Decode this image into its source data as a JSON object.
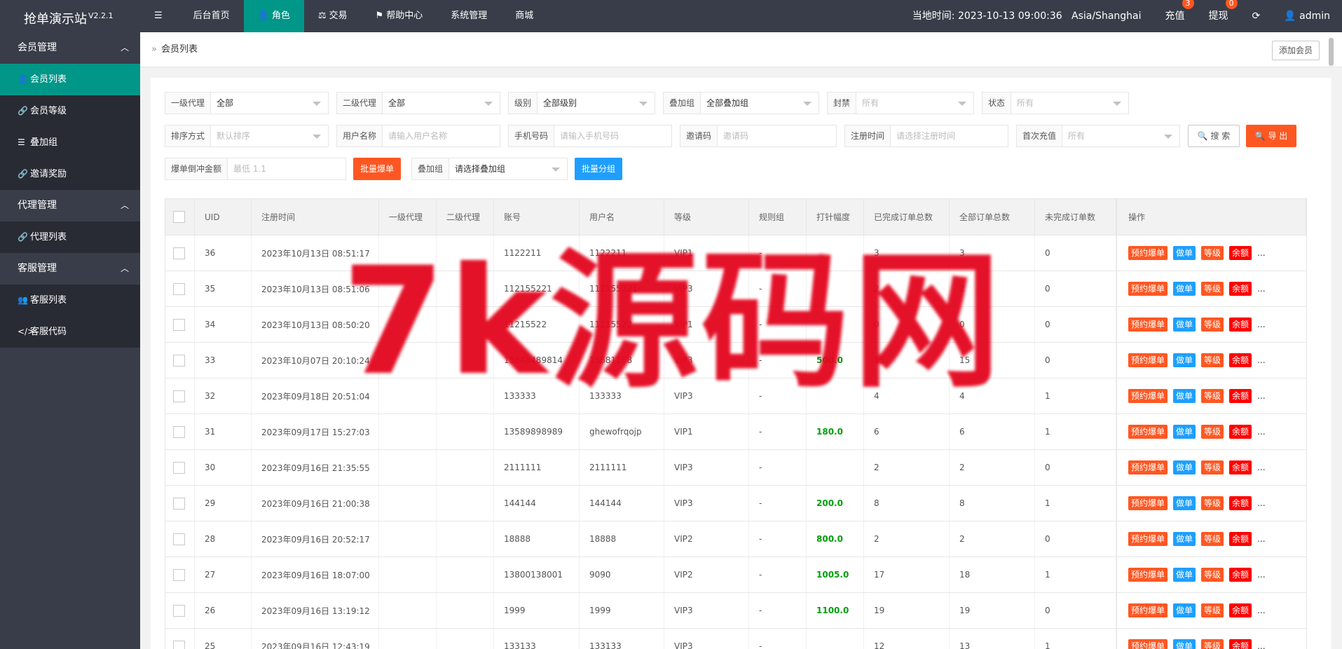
{
  "app": {
    "title": "抢单演示站",
    "version": "V2.2.1"
  },
  "topnav": {
    "items": [
      {
        "label": "后台首页",
        "icon": "menu-icon"
      },
      {
        "label": "角色",
        "icon": "user-icon"
      },
      {
        "label": "交易",
        "icon": "scale-icon"
      },
      {
        "label": "帮助中心",
        "icon": "flag-icon"
      },
      {
        "label": "系统管理"
      },
      {
        "label": "商城"
      }
    ],
    "active_index": 1,
    "time_label": "当地时间: 2023-10-13 09:00:36",
    "timezone": "Asia/Shanghai",
    "recharge": {
      "label": "充值",
      "badge": "3"
    },
    "withdraw": {
      "label": "提现",
      "badge": "0"
    },
    "refresh_icon": "refresh-icon",
    "user": "admin"
  },
  "sidebar": {
    "groups": [
      {
        "label": "会员管理",
        "items": [
          {
            "label": "会员列表",
            "icon": "user-icon",
            "active": true
          },
          {
            "label": "会员等级",
            "icon": "link-icon"
          },
          {
            "label": "叠加组",
            "icon": "list-icon"
          },
          {
            "label": "邀请奖励",
            "icon": "link-icon"
          }
        ]
      },
      {
        "label": "代理管理",
        "items": [
          {
            "label": "代理列表",
            "icon": "link-icon"
          }
        ]
      },
      {
        "label": "客服管理",
        "items": [
          {
            "label": "客服列表",
            "icon": "users-icon"
          },
          {
            "label": "客服代码",
            "icon": "code-icon"
          }
        ]
      }
    ]
  },
  "page": {
    "breadcrumb": "会员列表",
    "add_button": "添加会员"
  },
  "filters": {
    "row1": [
      {
        "label": "一级代理",
        "value": "全部",
        "select": true
      },
      {
        "label": "二级代理",
        "value": "全部",
        "select": true
      },
      {
        "label": "级别",
        "value": "全部级别",
        "select": true
      },
      {
        "label": "叠加组",
        "value": "全部叠加组",
        "select": true
      },
      {
        "label": "封禁",
        "placeholder": "所有",
        "select": true
      },
      {
        "label": "状态",
        "placeholder": "所有",
        "select": true
      }
    ],
    "row2": [
      {
        "label": "排序方式",
        "placeholder": "默认排序",
        "select": true
      },
      {
        "label": "用户名称",
        "placeholder": "请输入用户名称"
      },
      {
        "label": "手机号码",
        "placeholder": "请输入手机号码"
      },
      {
        "label": "邀请码",
        "placeholder": "邀请码"
      },
      {
        "label": "注册时间",
        "placeholder": "请选择注册时间"
      },
      {
        "label": "首次充值",
        "placeholder": "所有",
        "select": true
      }
    ],
    "search_button": "搜 索",
    "export_button": "导 出",
    "row3": {
      "amount_label": "爆单倒冲金额",
      "amount_placeholder": "最低 1.1",
      "batch_bomb_button": "批量爆单",
      "group_label": "叠加组",
      "group_value": "请选择叠加组",
      "batch_group_button": "批量分组"
    }
  },
  "table": {
    "headers": [
      "UID",
      "注册时间",
      "一级代理",
      "二级代理",
      "账号",
      "用户名",
      "等级",
      "规则组",
      "打针幅度",
      "已完成订单总数",
      "全部订单总数",
      "未完成订单数",
      "操作"
    ],
    "actions": [
      "预约爆单",
      "做单",
      "等级",
      "余额",
      "..."
    ],
    "rows": [
      {
        "uid": "36",
        "time": "2023年10月13日 08:51:17",
        "a1": "",
        "a2": "",
        "account": "1122211",
        "username": "1122211",
        "level": "VIP1",
        "rule": "-",
        "amp": "",
        "done": "3",
        "all": "3",
        "undone": "0"
      },
      {
        "uid": "35",
        "time": "2023年10月13日 08:51:06",
        "a1": "",
        "a2": "",
        "account": "112155221",
        "username": "112155221",
        "level": "VIP3",
        "rule": "-",
        "amp": "",
        "done": "2",
        "all": "2",
        "undone": "0"
      },
      {
        "uid": "34",
        "time": "2023年10月13日 08:50:20",
        "a1": "",
        "a2": "",
        "account": "11215522",
        "username": "11215522",
        "level": "VIP1",
        "rule": "-",
        "amp": "",
        "done": "0",
        "all": "0",
        "undone": "0"
      },
      {
        "uid": "33",
        "time": "2023年10月07日 20:10:24",
        "a1": "",
        "a2": "",
        "account": "15848489814",
        "username": "15681168",
        "level": "VIP3",
        "rule": "-",
        "amp": "500.0",
        "done": "15",
        "all": "15",
        "undone": "0"
      },
      {
        "uid": "32",
        "time": "2023年09月18日 20:51:04",
        "a1": "",
        "a2": "",
        "account": "133333",
        "username": "133333",
        "level": "VIP3",
        "rule": "-",
        "amp": "",
        "done": "4",
        "all": "4",
        "undone": "1"
      },
      {
        "uid": "31",
        "time": "2023年09月17日 15:27:03",
        "a1": "",
        "a2": "",
        "account": "13589898989",
        "username": "ghewofrqojp",
        "level": "VIP1",
        "rule": "-",
        "amp": "180.0",
        "done": "6",
        "all": "6",
        "undone": "1"
      },
      {
        "uid": "30",
        "time": "2023年09月16日 21:35:55",
        "a1": "",
        "a2": "",
        "account": "2111111",
        "username": "2111111",
        "level": "VIP3",
        "rule": "-",
        "amp": "",
        "done": "2",
        "all": "2",
        "undone": "0"
      },
      {
        "uid": "29",
        "time": "2023年09月16日 21:00:38",
        "a1": "",
        "a2": "",
        "account": "144144",
        "username": "144144",
        "level": "VIP3",
        "rule": "-",
        "amp": "200.0",
        "done": "8",
        "all": "8",
        "undone": "1"
      },
      {
        "uid": "28",
        "time": "2023年09月16日 20:52:17",
        "a1": "",
        "a2": "",
        "account": "18888",
        "username": "18888",
        "level": "VIP2",
        "rule": "-",
        "amp": "800.0",
        "done": "2",
        "all": "2",
        "undone": "0"
      },
      {
        "uid": "27",
        "time": "2023年09月16日 18:07:00",
        "a1": "",
        "a2": "",
        "account": "13800138001",
        "username": "9090",
        "level": "VIP2",
        "rule": "-",
        "amp": "1005.0",
        "done": "17",
        "all": "18",
        "undone": "1"
      },
      {
        "uid": "26",
        "time": "2023年09月16日 13:19:12",
        "a1": "",
        "a2": "",
        "account": "1999",
        "username": "1999",
        "level": "VIP3",
        "rule": "-",
        "amp": "1100.0",
        "done": "19",
        "all": "19",
        "undone": "0"
      },
      {
        "uid": "25",
        "time": "2023年09月16日 12:43:19",
        "a1": "",
        "a2": "",
        "account": "133133",
        "username": "133133",
        "level": "VIP3",
        "rule": "-",
        "amp": "",
        "done": "12",
        "all": "13",
        "undone": "1"
      }
    ]
  },
  "watermark": "7k源码网",
  "colors": {
    "topbar": "#393d49",
    "accent": "#009688",
    "orange": "#ff5722",
    "blue": "#1e9fff",
    "red": "#ff0000",
    "green": "#009f0e",
    "watermark": "#e3061e"
  }
}
